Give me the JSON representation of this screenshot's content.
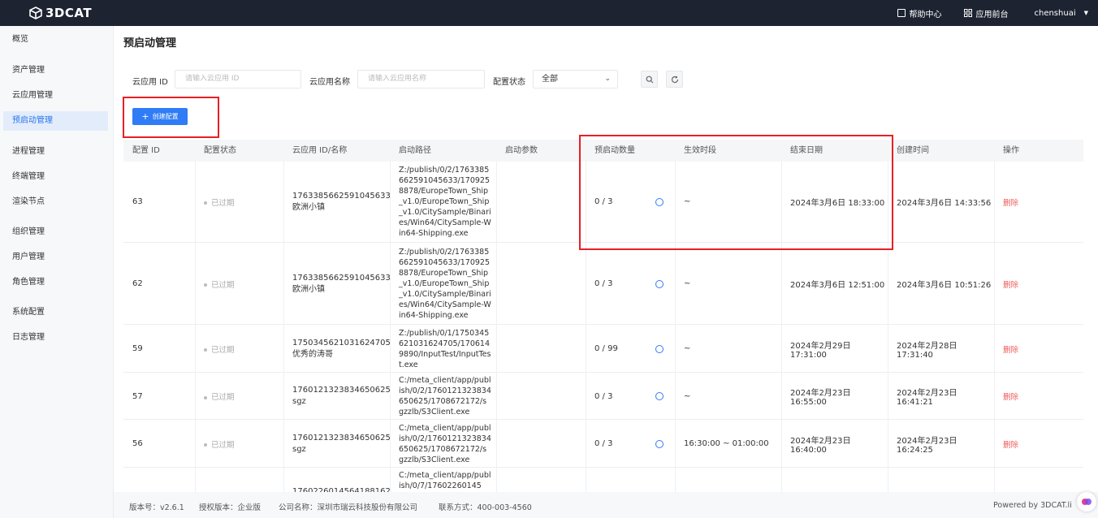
{
  "topbar": {
    "brand": "3DCAT",
    "help": "帮助中心",
    "app_front": "应用前台",
    "user": "chenshuai"
  },
  "sidebar": {
    "items": [
      {
        "label": "概览"
      },
      {
        "label": "资产管理"
      },
      {
        "label": "云应用管理"
      },
      {
        "label": "预启动管理"
      },
      {
        "label": "进程管理"
      },
      {
        "label": "终端管理"
      },
      {
        "label": "渲染节点"
      },
      {
        "label": "组织管理"
      },
      {
        "label": "用户管理"
      },
      {
        "label": "角色管理"
      },
      {
        "label": "系统配置"
      },
      {
        "label": "日志管理"
      }
    ]
  },
  "page": {
    "title": "预启动管理"
  },
  "filters": {
    "app_id_label": "云应用 ID",
    "app_id_placeholder": "请输入云应用 ID",
    "app_name_label": "云应用名称",
    "app_name_placeholder": "请输入云应用名称",
    "status_label": "配置状态",
    "status_value": "全部"
  },
  "create_button": "创建配置",
  "table": {
    "headers": {
      "id": "配置 ID",
      "status": "配置状态",
      "app": "云应用 ID/名称",
      "path": "启动路径",
      "params": "启动参数",
      "count": "预启动数量",
      "period": "生效时段",
      "end": "结束日期",
      "created": "创建时间",
      "action": "操作"
    },
    "rows": [
      {
        "id": "63",
        "status": "已过期",
        "app_id": "1763385662591045633",
        "app_name": "欧洲小镇",
        "path": "Z:/publish/0/2/1763385662591045633/1709258878/EuropeTown_Ship_v1.0/EuropeTown_Ship_v1.0/CitySample/Binaries/Win64/CitySample-Win64-Shipping.exe",
        "params": "",
        "count": "0 / 3",
        "period": "~",
        "end": "2024年3月6日 18:33:00",
        "created": "2024年3月6日 14:33:56",
        "action": "删除"
      },
      {
        "id": "62",
        "status": "已过期",
        "app_id": "1763385662591045633",
        "app_name": "欧洲小镇",
        "path": "Z:/publish/0/2/1763385662591045633/1709258878/EuropeTown_Ship_v1.0/EuropeTown_Ship_v1.0/CitySample/Binaries/Win64/CitySample-Win64-Shipping.exe",
        "params": "",
        "count": "0 / 3",
        "period": "~",
        "end": "2024年3月6日 12:51:00",
        "created": "2024年3月6日 10:51:26",
        "action": "删除"
      },
      {
        "id": "59",
        "status": "已过期",
        "app_id": "1750345621031624705",
        "app_name": "优秀的涛哥",
        "path": "Z:/publish/0/1/1750345621031624705/1706149890/InputTest/InputTest.exe",
        "params": "",
        "count": "0 / 99",
        "period": "~",
        "end": "2024年2月29日 17:31:00",
        "created": "2024年2月28日 17:31:40",
        "action": "删除"
      },
      {
        "id": "57",
        "status": "已过期",
        "app_id": "1760121323834650625",
        "app_name": "sgz",
        "path": "C:/meta_client/app/publish/0/2/1760121323834650625/1708672172/sgzzlb/S3Client.exe",
        "params": "",
        "count": "0 / 3",
        "period": "~",
        "end": "2024年2月23日 16:55:00",
        "created": "2024年2月23日 16:41:21",
        "action": "删除"
      },
      {
        "id": "56",
        "status": "已过期",
        "app_id": "1760121323834650625",
        "app_name": "sgz",
        "path": "C:/meta_client/app/publish/0/2/1760121323834650625/1708672172/sgzzlb/S3Client.exe",
        "params": "",
        "count": "0 / 3",
        "period": "16:30:00 ~ 01:00:00",
        "end": "2024年2月23日 16:40:00",
        "created": "2024年2月23日 16:24:25",
        "action": "删除"
      },
      {
        "id": "",
        "status": "",
        "app_id": "1760226014564188162",
        "app_name": "",
        "path": "C:/meta_client/app/publish/0/7/17602260145",
        "params": "",
        "count": "",
        "period": "",
        "end": "",
        "created": "",
        "action": ""
      }
    ]
  },
  "footer": {
    "version": "版本号：v2.6.1",
    "license": "授权版本：企业版",
    "company": "公司名称：深圳市瑞云科技股份有限公司",
    "contact": "联系方式：400-003-4560",
    "powered": "Powered by 3DCAT.li"
  },
  "colors": {
    "topbar": "#1d2331",
    "accent": "#2f7cf6",
    "annotation": "#e81f23",
    "delete": "#f05a5a"
  }
}
